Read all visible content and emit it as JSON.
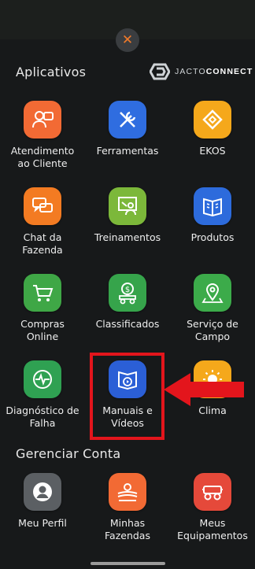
{
  "close_symbol": "✕",
  "apps_section": {
    "title": "Aplicativos",
    "brand": {
      "prefix": "JACTO",
      "suffix": "CONNECT"
    },
    "items": [
      {
        "label": "Atendimento\nao Cliente",
        "icon": "chat-bubbles-icon",
        "color": "#f26a34"
      },
      {
        "label": "Ferramentas",
        "icon": "tools-icon",
        "color": "#2f6de0"
      },
      {
        "label": "EKOS",
        "icon": "ekos-diamond-icon",
        "color": "#f5a81b"
      },
      {
        "label": "Chat da\nFazenda",
        "icon": "chat-icon",
        "color": "#f37b22"
      },
      {
        "label": "Treinamentos",
        "icon": "presentation-board-icon",
        "color": "#7cb83a"
      },
      {
        "label": "Produtos",
        "icon": "book-icon",
        "color": "#2d6bdc"
      },
      {
        "label": "Compras\nOnline",
        "icon": "shopping-cart-icon",
        "color": "#3fa746"
      },
      {
        "label": "Classificados",
        "icon": "tractor-money-icon",
        "color": "#36a44b"
      },
      {
        "label": "Serviço de\nCampo",
        "icon": "map-pin-icon",
        "color": "#3cab4a"
      },
      {
        "label": "Diagnóstico de\nFalha",
        "icon": "pulse-icon",
        "color": "#2fa152"
      },
      {
        "label": "Manuais e\nVídeos",
        "icon": "manual-video-icon",
        "color": "#2b5fd6"
      },
      {
        "label": "Clima",
        "icon": "sun-icon",
        "color": "#f5a81b"
      }
    ]
  },
  "account_section": {
    "title": "Gerenciar Conta",
    "items": [
      {
        "label": "Meu Perfil",
        "icon": "user-profile-icon",
        "color": "#5b5f63"
      },
      {
        "label": "Minhas\nFazendas",
        "icon": "farm-fields-icon",
        "color": "#f26a34"
      },
      {
        "label": "Meus\nEquipamentos",
        "icon": "sprayer-equipment-icon",
        "color": "#e5493a"
      }
    ]
  },
  "annotation": {
    "highlight_color": "#e3151c"
  }
}
